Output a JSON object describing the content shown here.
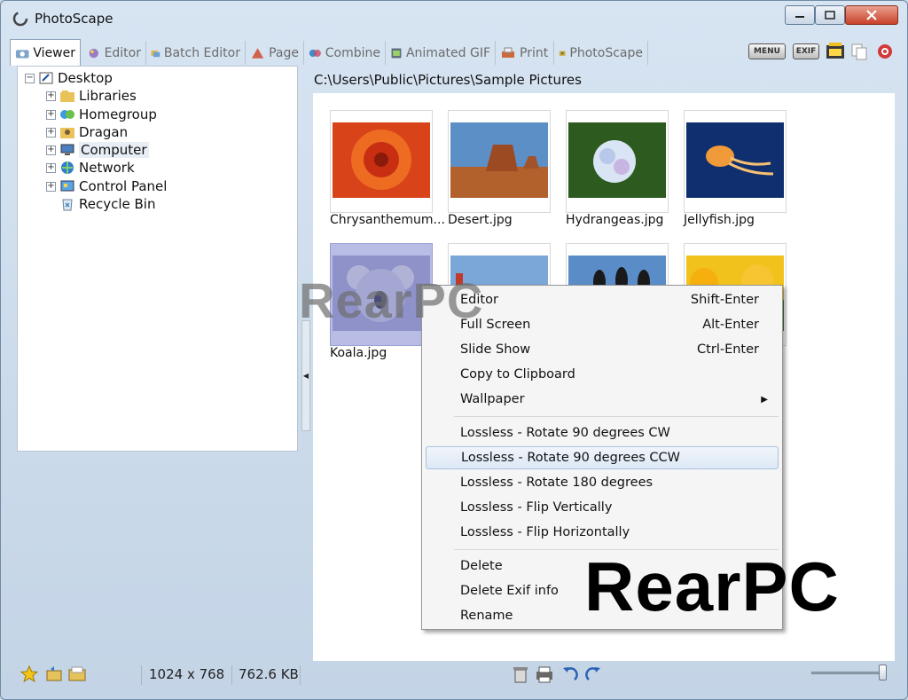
{
  "window": {
    "title": "PhotoScape"
  },
  "tabs": [
    {
      "label": "Viewer",
      "icon": "viewer-icon",
      "active": true
    },
    {
      "label": "Editor",
      "icon": "editor-icon",
      "active": false
    },
    {
      "label": "Batch Editor",
      "icon": "batch-editor-icon",
      "active": false
    },
    {
      "label": "Page",
      "icon": "page-icon",
      "active": false
    },
    {
      "label": "Combine",
      "icon": "combine-icon",
      "active": false
    },
    {
      "label": "Animated GIF",
      "icon": "animated-gif-icon",
      "active": false
    },
    {
      "label": "Print",
      "icon": "print-icon",
      "active": false
    },
    {
      "label": "PhotoScape",
      "icon": "photoscape-icon",
      "active": false
    }
  ],
  "toolbar_right": {
    "menu_label": "MENU",
    "exif_label": "EXIF"
  },
  "tree": {
    "root": "Desktop",
    "items": [
      {
        "label": "Libraries",
        "icon": "libraries-icon"
      },
      {
        "label": "Homegroup",
        "icon": "homegroup-icon"
      },
      {
        "label": "Dragan",
        "icon": "user-folder-icon"
      },
      {
        "label": "Computer",
        "icon": "computer-icon"
      },
      {
        "label": "Network",
        "icon": "network-icon"
      },
      {
        "label": "Control Panel",
        "icon": "control-panel-icon"
      },
      {
        "label": "Recycle Bin",
        "icon": "recycle-bin-icon"
      }
    ]
  },
  "path": "C:\\Users\\Public\\Pictures\\Sample Pictures",
  "thumbnails": [
    {
      "label": "Chrysanthemum...",
      "color": "#d8431a"
    },
    {
      "label": "Desert.jpg",
      "color": "#b25a2a"
    },
    {
      "label": "Hydrangeas.jpg",
      "color": "#3f6a2c"
    },
    {
      "label": "Jellyfish.jpg",
      "color": "#12326e"
    },
    {
      "label": "Koala.jpg",
      "color": "#8f90c8"
    },
    {
      "label": "",
      "color": "#d9b47c"
    },
    {
      "label": "",
      "color": "#5a8dc8"
    },
    {
      "label": "",
      "color": "#f2c21c"
    }
  ],
  "context_menu": {
    "items": [
      {
        "label": "Editor",
        "shortcut": "Shift-Enter"
      },
      {
        "label": "Full Screen",
        "shortcut": "Alt-Enter"
      },
      {
        "label": "Slide Show",
        "shortcut": "Ctrl-Enter"
      },
      {
        "label": "Copy to Clipboard",
        "shortcut": ""
      },
      {
        "label": "Wallpaper",
        "shortcut": "",
        "submenu": true
      },
      {
        "label": "Lossless - Rotate 90 degrees CW",
        "shortcut": ""
      },
      {
        "label": "Lossless - Rotate 90 degrees CCW",
        "shortcut": "",
        "highlighted": true
      },
      {
        "label": "Lossless - Rotate 180 degrees",
        "shortcut": ""
      },
      {
        "label": "Lossless - Flip Vertically",
        "shortcut": ""
      },
      {
        "label": "Lossless - Flip Horizontally",
        "shortcut": ""
      },
      {
        "label": "Delete",
        "shortcut": ""
      },
      {
        "label": "Delete Exif info",
        "shortcut": ""
      },
      {
        "label": "Rename",
        "shortcut": ""
      }
    ]
  },
  "status": {
    "dimensions": "1024 x 768",
    "file_size": "762.6 KB"
  },
  "watermarks": {
    "gray": "RearPC",
    "black": "RearPC"
  },
  "colors": {
    "accent": "#a9c3e0",
    "close_button": "#c8412a"
  }
}
